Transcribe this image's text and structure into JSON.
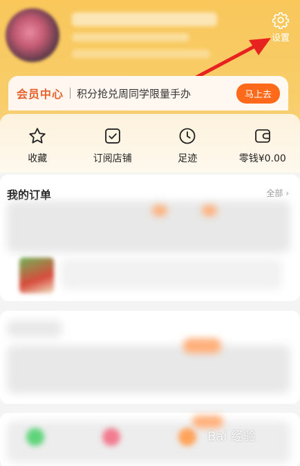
{
  "header": {
    "settings_label": "设置"
  },
  "member_banner": {
    "title": "会员中心",
    "text": "积分抢兑周同学限量手办",
    "button_label": "马上去"
  },
  "quick_actions": [
    {
      "label": "收藏",
      "icon": "star-icon"
    },
    {
      "label": "订阅店铺",
      "icon": "checkbox-icon"
    },
    {
      "label": "足迹",
      "icon": "clock-icon"
    },
    {
      "label": "零钱¥0.00",
      "icon": "wallet-icon"
    }
  ],
  "orders": {
    "title": "我的订单",
    "more_label": "全部 ›"
  },
  "watermark": "Bai 经验"
}
